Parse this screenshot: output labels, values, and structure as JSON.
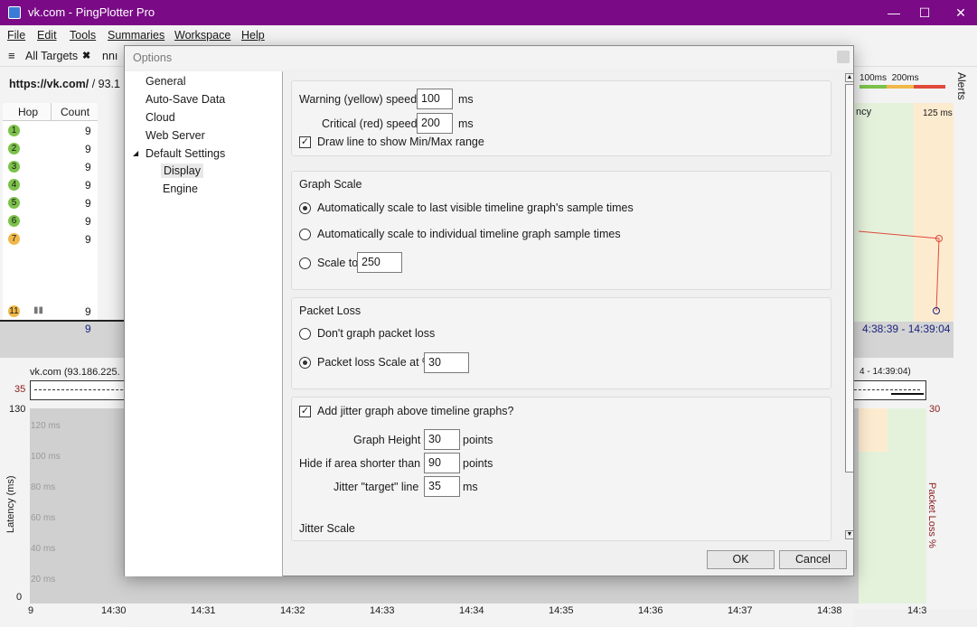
{
  "window": {
    "title": "vk.com - PingPlotter Pro",
    "minimize_glyph": "—",
    "maximize_glyph": "☐",
    "close_glyph": "✕"
  },
  "menu": [
    "File",
    "Edit",
    "Tools",
    "Summaries",
    "Workspace",
    "Help"
  ],
  "tabs": {
    "all_targets": "All Targets",
    "close_glyph": "✖",
    "partial": "nnı"
  },
  "target": {
    "url_bold": "https://vk.com/",
    "url_rest": " / 93.1"
  },
  "hop_table": {
    "headers": [
      "Hop",
      "Count"
    ],
    "rows": [
      {
        "hop": "1",
        "count": "9"
      },
      {
        "hop": "2",
        "count": "9"
      },
      {
        "hop": "3",
        "count": "9"
      },
      {
        "hop": "4",
        "count": "9"
      },
      {
        "hop": "5",
        "count": "9"
      },
      {
        "hop": "6",
        "count": "9"
      },
      {
        "hop": "7",
        "count": "9"
      }
    ],
    "last_row": {
      "hop": "11",
      "count": "9"
    },
    "total": "9"
  },
  "right_panel": {
    "legend_100": "100ms",
    "legend_200": "200ms",
    "alerts": "Alerts",
    "latency_partial": "ncy",
    "scale_125": "125 ms",
    "time_range": "4:38:39 - 14:39:04",
    "bottom_range": "4 - 14:39:04)"
  },
  "bottom_graph": {
    "title": "vk.com (93.186.225.",
    "jitter_scale": "35",
    "ymax": "130",
    "ymin": "0",
    "ylabel": "Latency (ms)",
    "right_label": "Packet Loss %",
    "loss_top": "30",
    "gridlabels": [
      "120 ms",
      "100 ms",
      "80 ms",
      "60 ms",
      "40 ms",
      "20 ms"
    ],
    "ticks": [
      "9",
      "14:30",
      "14:31",
      "14:32",
      "14:33",
      "14:34",
      "14:35",
      "14:36",
      "14:37",
      "14:38",
      "14:3"
    ]
  },
  "dialog": {
    "title": "Options",
    "tree": {
      "general": "General",
      "autosave": "Auto-Save Data",
      "cloud": "Cloud",
      "webserver": "Web Server",
      "default_settings": "Default Settings",
      "expander": "◢",
      "display": "Display",
      "engine": "Engine"
    },
    "speed": {
      "warning_label": "Warning (yellow) speed",
      "warning_value": "100",
      "critical_label": "Critical (red) speed",
      "critical_value": "200",
      "ms": "ms",
      "draw_line_label": "Draw line to show Min/Max range"
    },
    "graph_scale": {
      "heading": "Graph Scale",
      "opt1": "Automatically scale to last visible timeline graph's sample times",
      "opt2": "Automatically scale to individual timeline graph sample times",
      "opt3": "Scale to:",
      "scale_value": "250"
    },
    "packet_loss": {
      "heading": "Packet Loss",
      "opt1": "Don't graph packet loss",
      "opt2": "Packet loss Scale at %",
      "scale_value": "30"
    },
    "jitter": {
      "add_label": "Add jitter graph above timeline graphs?",
      "height_label": "Graph Height",
      "height_value": "30",
      "points": "points",
      "hide_label": "Hide if area shorter than",
      "hide_value": "90",
      "target_label": "Jitter \"target\" line",
      "target_value": "35",
      "ms": "ms",
      "scale_heading": "Jitter Scale"
    },
    "ok": "OK",
    "cancel": "Cancel",
    "check_glyph": "✓"
  },
  "colors": {
    "titlebar": "#7a0a86",
    "good": "#7cc24a",
    "warning": "#f0b84a",
    "critical": "#e04a3a"
  }
}
